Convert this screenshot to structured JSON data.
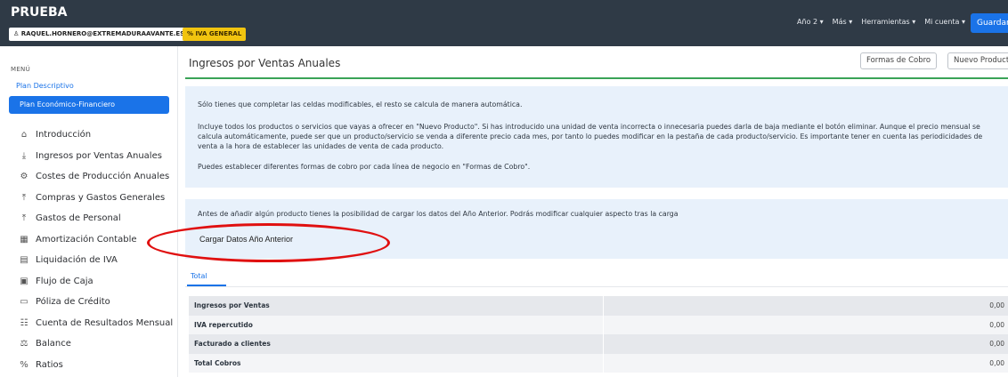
{
  "header": {
    "brand": "PRUEBA",
    "user": "RAQUEL.HORNERO@EXTREMADURAAVANTE.ES",
    "iva_badge": "IVA GENERAL",
    "nav": [
      "Año 2 ▾",
      "Más ▾",
      "Herramientas ▾",
      "Mi cuenta ▾"
    ],
    "save_button": "Guardar"
  },
  "sidebar": {
    "menu_title": "MENÚ",
    "plan_descriptivo": "Plan Descriptivo",
    "plan_economico": "Plan Económico-Financiero",
    "items": [
      {
        "label": "Introducción",
        "icon": "home-icon"
      },
      {
        "label": "Ingresos por Ventas Anuales",
        "icon": "download-icon"
      },
      {
        "label": "Costes de Producción Anuales",
        "icon": "gear-icon"
      },
      {
        "label": "Compras y Gastos Generales",
        "icon": "upload-icon"
      },
      {
        "label": "Gastos de Personal",
        "icon": "upload-icon"
      },
      {
        "label": "Amortización Contable",
        "icon": "building-icon"
      },
      {
        "label": "Liquidación de IVA",
        "icon": "document-icon"
      },
      {
        "label": "Flujo de Caja",
        "icon": "cash-icon"
      },
      {
        "label": "Póliza de Crédito",
        "icon": "card-icon"
      },
      {
        "label": "Cuenta de Resultados Mensual",
        "icon": "list-icon"
      },
      {
        "label": "Balance",
        "icon": "balance-icon"
      },
      {
        "label": "Ratios",
        "icon": "percent-icon"
      }
    ]
  },
  "main": {
    "title": "Ingresos por Ventas Anuales",
    "buttons": {
      "formas_cobro": "Formas de Cobro",
      "nuevo_producto": "Nuevo Producto"
    },
    "info": {
      "p1": "Sólo tienes que completar las celdas modificables, el resto se calcula de manera automática.",
      "p2": "Incluye todos los productos o servicios que vayas a ofrecer en \"Nuevo Producto\". Si has introducido una unidad de venta incorrecta o innecesaria puedes darla de baja mediante el botón eliminar. Aunque el precio mensual se calcula automáticamente, puede ser que un producto/servicio se venda a diferente precio cada mes, por tanto lo puedes modificar en la pestaña de cada producto/servicio. Es importante tener en cuenta las periodicidades de venta a la hora de establecer las unidades de venta de cada producto.",
      "p3": "Puedes establecer diferentes formas de cobro por cada línea de negocio en \"Formas de Cobro\"."
    },
    "info2": {
      "text": "Antes de añadir algún producto tienes la posibilidad de cargar los datos del Año Anterior. Podrás modificar cualquier aspecto tras la carga",
      "button": "Cargar Datos Año Anterior"
    },
    "tab": "Total",
    "table": [
      {
        "label": "Ingresos por Ventas",
        "value": "0,00"
      },
      {
        "label": "IVA repercutido",
        "value": "0,00"
      },
      {
        "label": "Facturado a clientes",
        "value": "0,00"
      },
      {
        "label": "Total Cobros",
        "value": "0,00"
      }
    ]
  },
  "colors": {
    "header_bg": "#2f3a46",
    "accent": "#1a73e8",
    "iva_badge": "#f1c40f",
    "annotation": "#e01010",
    "separator": "#3aa357"
  }
}
